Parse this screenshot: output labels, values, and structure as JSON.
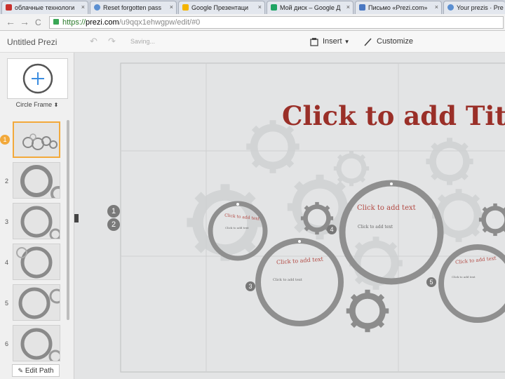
{
  "browser": {
    "tabs": [
      {
        "title": "облачные технологи",
        "fav_color": "#c9302c"
      },
      {
        "title": "Reset forgotten pass",
        "fav_color": "#5b8fd1"
      },
      {
        "title": "Google Презентаци",
        "fav_color": "#f4b400"
      },
      {
        "title": "Мой диск – Google Д",
        "fav_color": "#1fa463"
      },
      {
        "title": "Письмо «Prezi.com»",
        "fav_color": "#4a78c2"
      },
      {
        "title": "Your prezis · Pre",
        "fav_color": "#5b8fd1"
      }
    ],
    "tab_close": "×",
    "back": "←",
    "forward": "→",
    "reload": "C",
    "url_scheme": "https://",
    "url_host": "prezi.com",
    "url_path": "/u9qqx1ehwgpw/edit/#0"
  },
  "prezi": {
    "title": "Untitled Prezi",
    "undo": "↶",
    "redo": "↷",
    "saving": "Saving...",
    "insert_label": "Insert",
    "customize_label": "Customize",
    "frame_type": "Circle Frame",
    "edit_path": "Edit Path",
    "thumbnails": [
      "1",
      "2",
      "3",
      "4",
      "5",
      "6"
    ]
  },
  "canvas": {
    "title": "Click to add Title",
    "ring_big_title": "Click to add text",
    "ring_big_sub": "Click to add text",
    "ring_left_title": "Click to add text",
    "ring_left_sub": "Click to add text",
    "ring_mid_title": "Click to add text",
    "ring_mid_sub": "Click to add text",
    "ring_right_title": "Click to add text",
    "ring_right_sub": "Click to add text",
    "path_markers": [
      "1",
      "2"
    ],
    "step_markers": [
      "3",
      "4",
      "5"
    ]
  },
  "colors": {
    "title_red": "#9a2f28",
    "accent_orange": "#f2a93b",
    "ring_gray": "#8f8f8f"
  }
}
